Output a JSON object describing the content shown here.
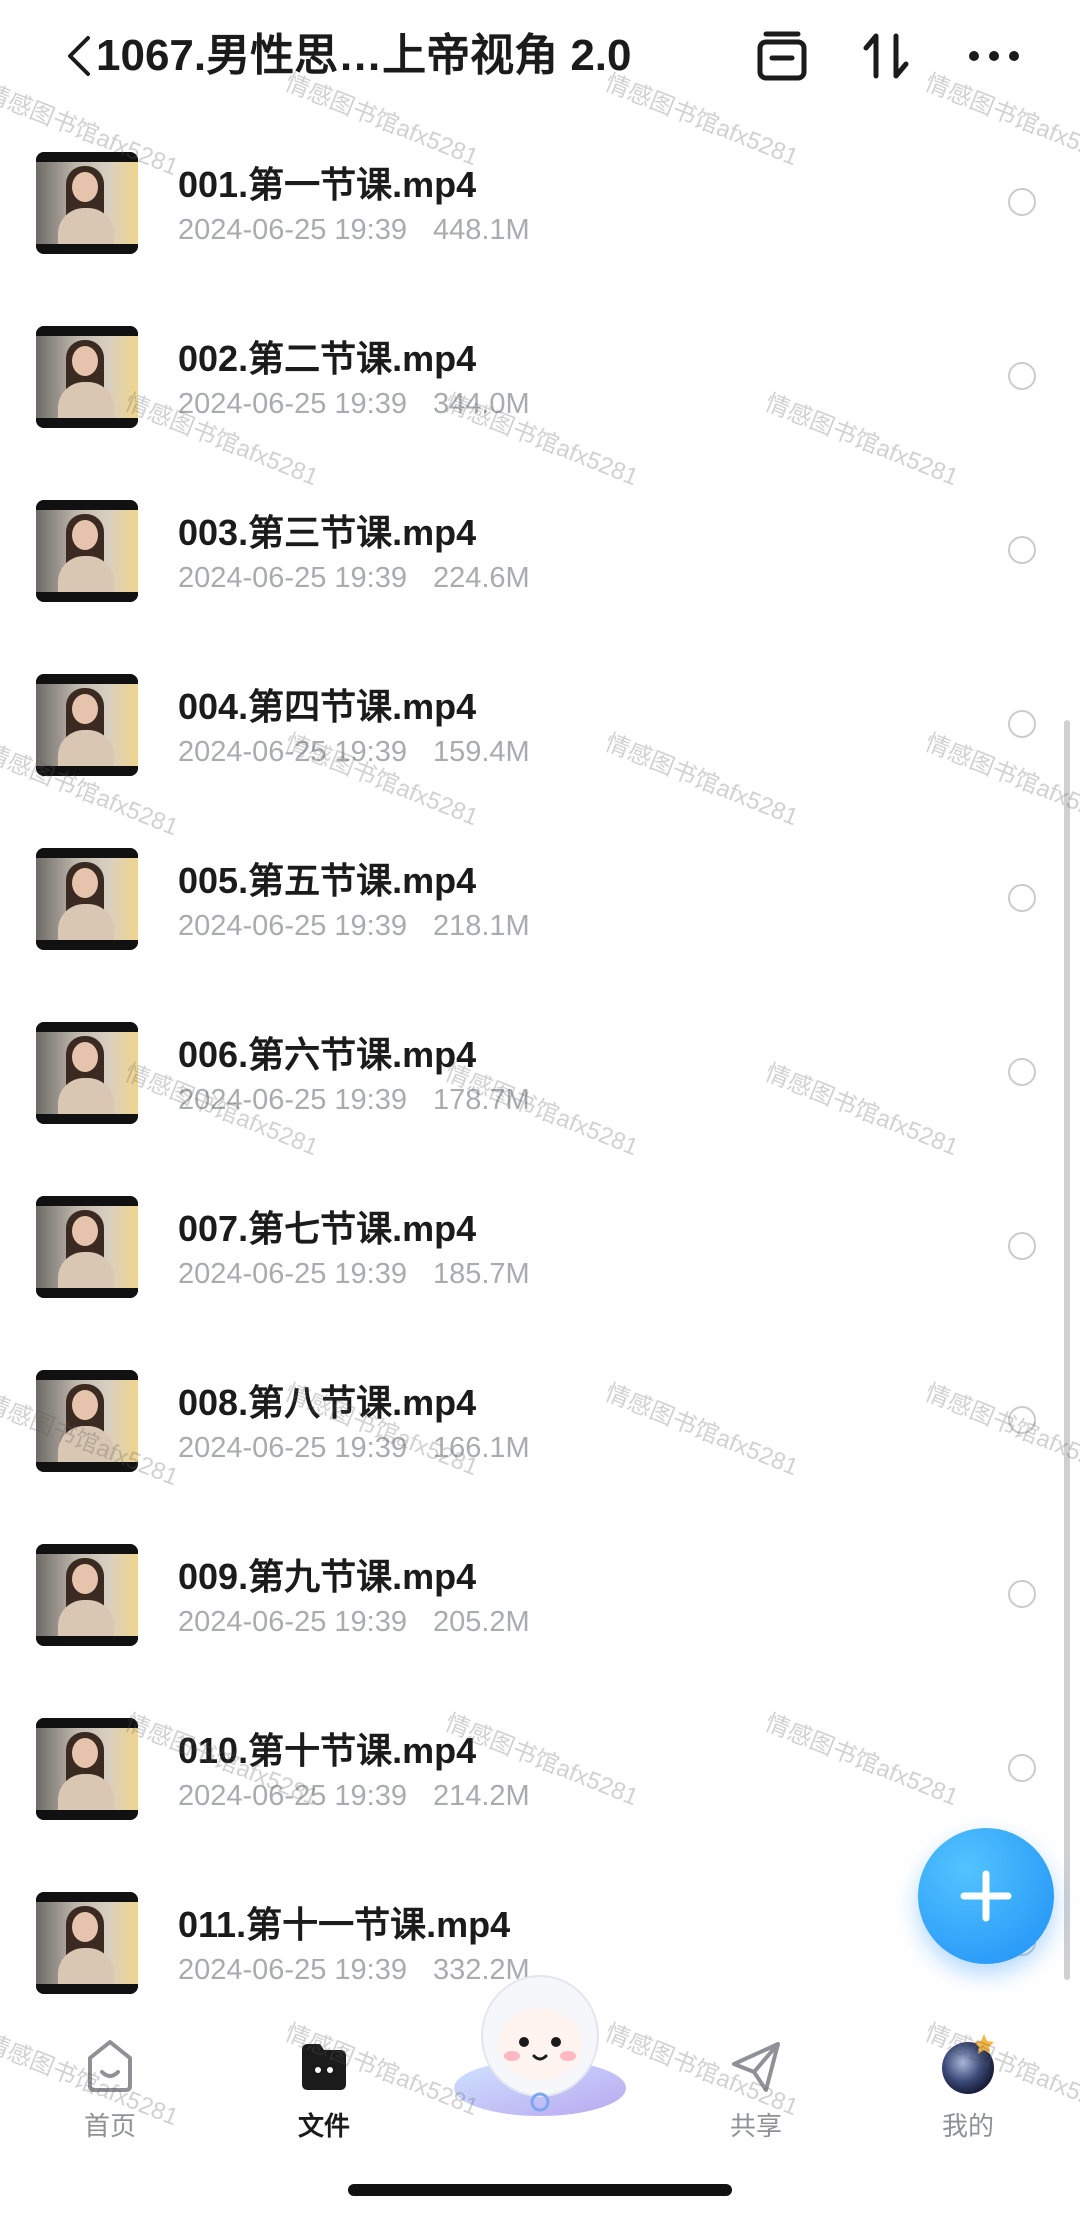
{
  "header": {
    "title": "1067.男性思…上帝视角 2.0",
    "icons": [
      "back-icon",
      "select-all-icon",
      "sort-icon",
      "more-icon"
    ]
  },
  "files": [
    {
      "name": "001.第一节课.mp4",
      "date": "2024-06-25 19:39",
      "size": "448.1M"
    },
    {
      "name": "002.第二节课.mp4",
      "date": "2024-06-25 19:39",
      "size": "344.0M"
    },
    {
      "name": "003.第三节课.mp4",
      "date": "2024-06-25 19:39",
      "size": "224.6M"
    },
    {
      "name": "004.第四节课.mp4",
      "date": "2024-06-25 19:39",
      "size": "159.4M"
    },
    {
      "name": "005.第五节课.mp4",
      "date": "2024-06-25 19:39",
      "size": "218.1M"
    },
    {
      "name": "006.第六节课.mp4",
      "date": "2024-06-25 19:39",
      "size": "178.7M"
    },
    {
      "name": "007.第七节课.mp4",
      "date": "2024-06-25 19:39",
      "size": "185.7M"
    },
    {
      "name": "008.第八节课.mp4",
      "date": "2024-06-25 19:39",
      "size": "166.1M"
    },
    {
      "name": "009.第九节课.mp4",
      "date": "2024-06-25 19:39",
      "size": "205.2M"
    },
    {
      "name": "010.第十节课.mp4",
      "date": "2024-06-25 19:39",
      "size": "214.2M"
    },
    {
      "name": "011.第十一节课.mp4",
      "date": "2024-06-25 19:39",
      "size": "332.2M"
    }
  ],
  "fab": {
    "icon": "plus-icon"
  },
  "tabbar": {
    "tabs": [
      {
        "label": "首页",
        "icon": "home-icon"
      },
      {
        "label": "文件",
        "icon": "folder-icon",
        "active": true
      },
      {
        "label": "",
        "icon": "mascot-icon"
      },
      {
        "label": "共享",
        "icon": "share-icon"
      },
      {
        "label": "我的",
        "icon": "avatar-icon"
      }
    ]
  },
  "watermark": "情感图书馆afx5281",
  "colors": {
    "accent": "#1f8ff5",
    "text": "#1b1b1b",
    "meta": "#a9abb0"
  }
}
